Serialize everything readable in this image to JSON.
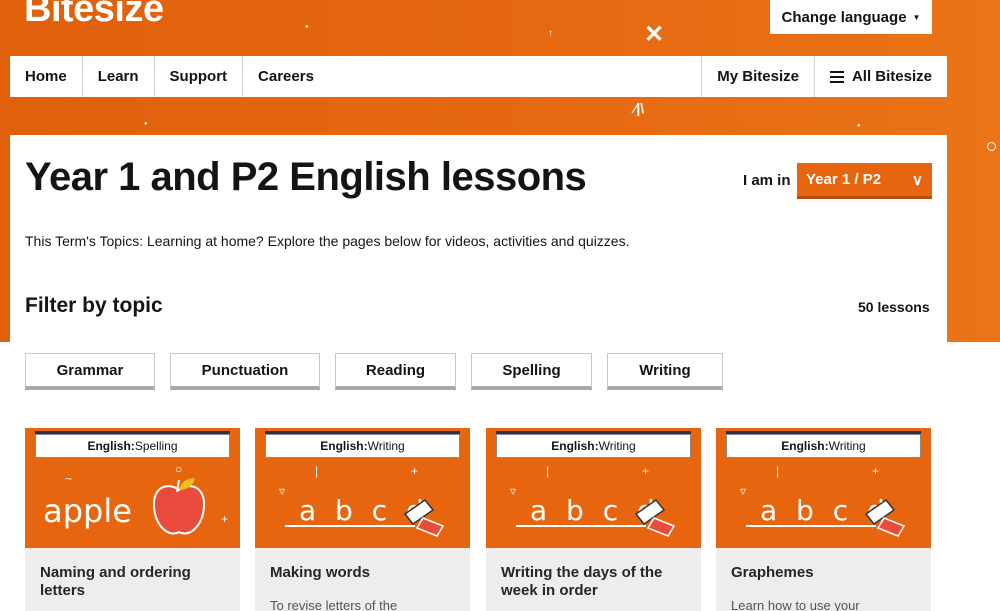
{
  "header": {
    "brand": "Bitesize",
    "change_language": "Change language"
  },
  "nav": {
    "home": "Home",
    "learn": "Learn",
    "support": "Support",
    "careers": "Careers",
    "my_bitesize": "My Bitesize",
    "all_bitesize": "All Bitesize"
  },
  "main": {
    "title": "Year 1 and P2 English lessons",
    "i_am_in": "I am in",
    "year_select": "Year 1 / P2",
    "intro": "This Term's Topics: Learning at home? Explore the pages below for videos, activities and quizzes.",
    "filter_title": "Filter by topic",
    "lesson_count": "50 lessons"
  },
  "topics": [
    "Grammar",
    "Punctuation",
    "Reading",
    "Spelling",
    "Writing"
  ],
  "cards": [
    {
      "tag_subject": "English:",
      "tag_topic": " Spelling",
      "image_word": "apple",
      "title": "Naming and ordering letters",
      "desc": ""
    },
    {
      "tag_subject": "English:",
      "tag_topic": " Writing",
      "image_word": "a b c d",
      "title": "Making words",
      "desc": "To revise letters of the"
    },
    {
      "tag_subject": "English:",
      "tag_topic": " Writing",
      "image_word": "a b c d",
      "title": "Writing the days of the week in order",
      "desc": ""
    },
    {
      "tag_subject": "English:",
      "tag_topic": " Writing",
      "image_word": "a b c d",
      "title": "Graphemes",
      "desc": "Learn how to use your"
    }
  ],
  "colors": {
    "brand_orange": "#e8650f",
    "text": "#141414",
    "card_bg": "#ededed"
  }
}
